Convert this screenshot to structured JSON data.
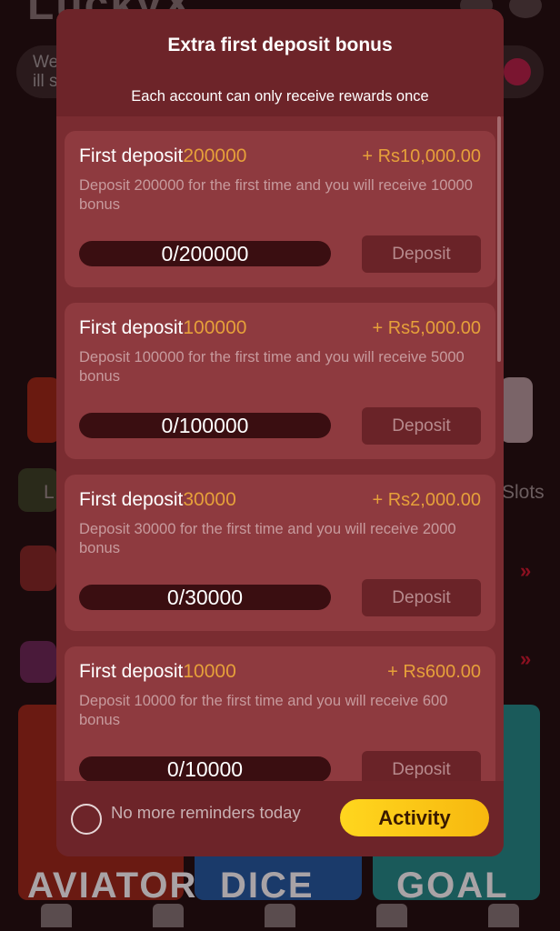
{
  "background": {
    "logo": "LuckyX",
    "marquee_text": "We\nill s",
    "row_labels": [
      "L",
      "Slots"
    ],
    "games": [
      "AVIATOR",
      "DICE",
      "GOAL"
    ]
  },
  "modal": {
    "title": "Extra first deposit bonus",
    "subtitle": "Each account can only receive rewards once",
    "cards": [
      {
        "title_prefix": "First deposit",
        "title_amount": "200000",
        "reward": "+ Rs10,000.00",
        "description": "Deposit 200000 for the first time and you will receive 10000 bonus",
        "progress": "0/200000",
        "button": "Deposit"
      },
      {
        "title_prefix": "First deposit",
        "title_amount": "100000",
        "reward": "+ Rs5,000.00",
        "description": "Deposit 100000 for the first time and you will receive 5000 bonus",
        "progress": "0/100000",
        "button": "Deposit"
      },
      {
        "title_prefix": "First deposit",
        "title_amount": "30000",
        "reward": "+ Rs2,000.00",
        "description": "Deposit 30000 for the first time and you will receive 2000 bonus",
        "progress": "0/30000",
        "button": "Deposit"
      },
      {
        "title_prefix": "First deposit",
        "title_amount": "10000",
        "reward": "+ Rs600.00",
        "description": "Deposit 10000 for the first time and you will receive 600 bonus",
        "progress": "0/10000",
        "button": "Deposit"
      }
    ],
    "footer": {
      "reminder_label": "No more reminders today",
      "activity_button": "Activity"
    }
  },
  "colors": {
    "accent_gold": "#e6a03a",
    "modal_bg": "#7a2c31",
    "card_bg": "#8e3a3f",
    "activity_button": "#ffd61e"
  }
}
